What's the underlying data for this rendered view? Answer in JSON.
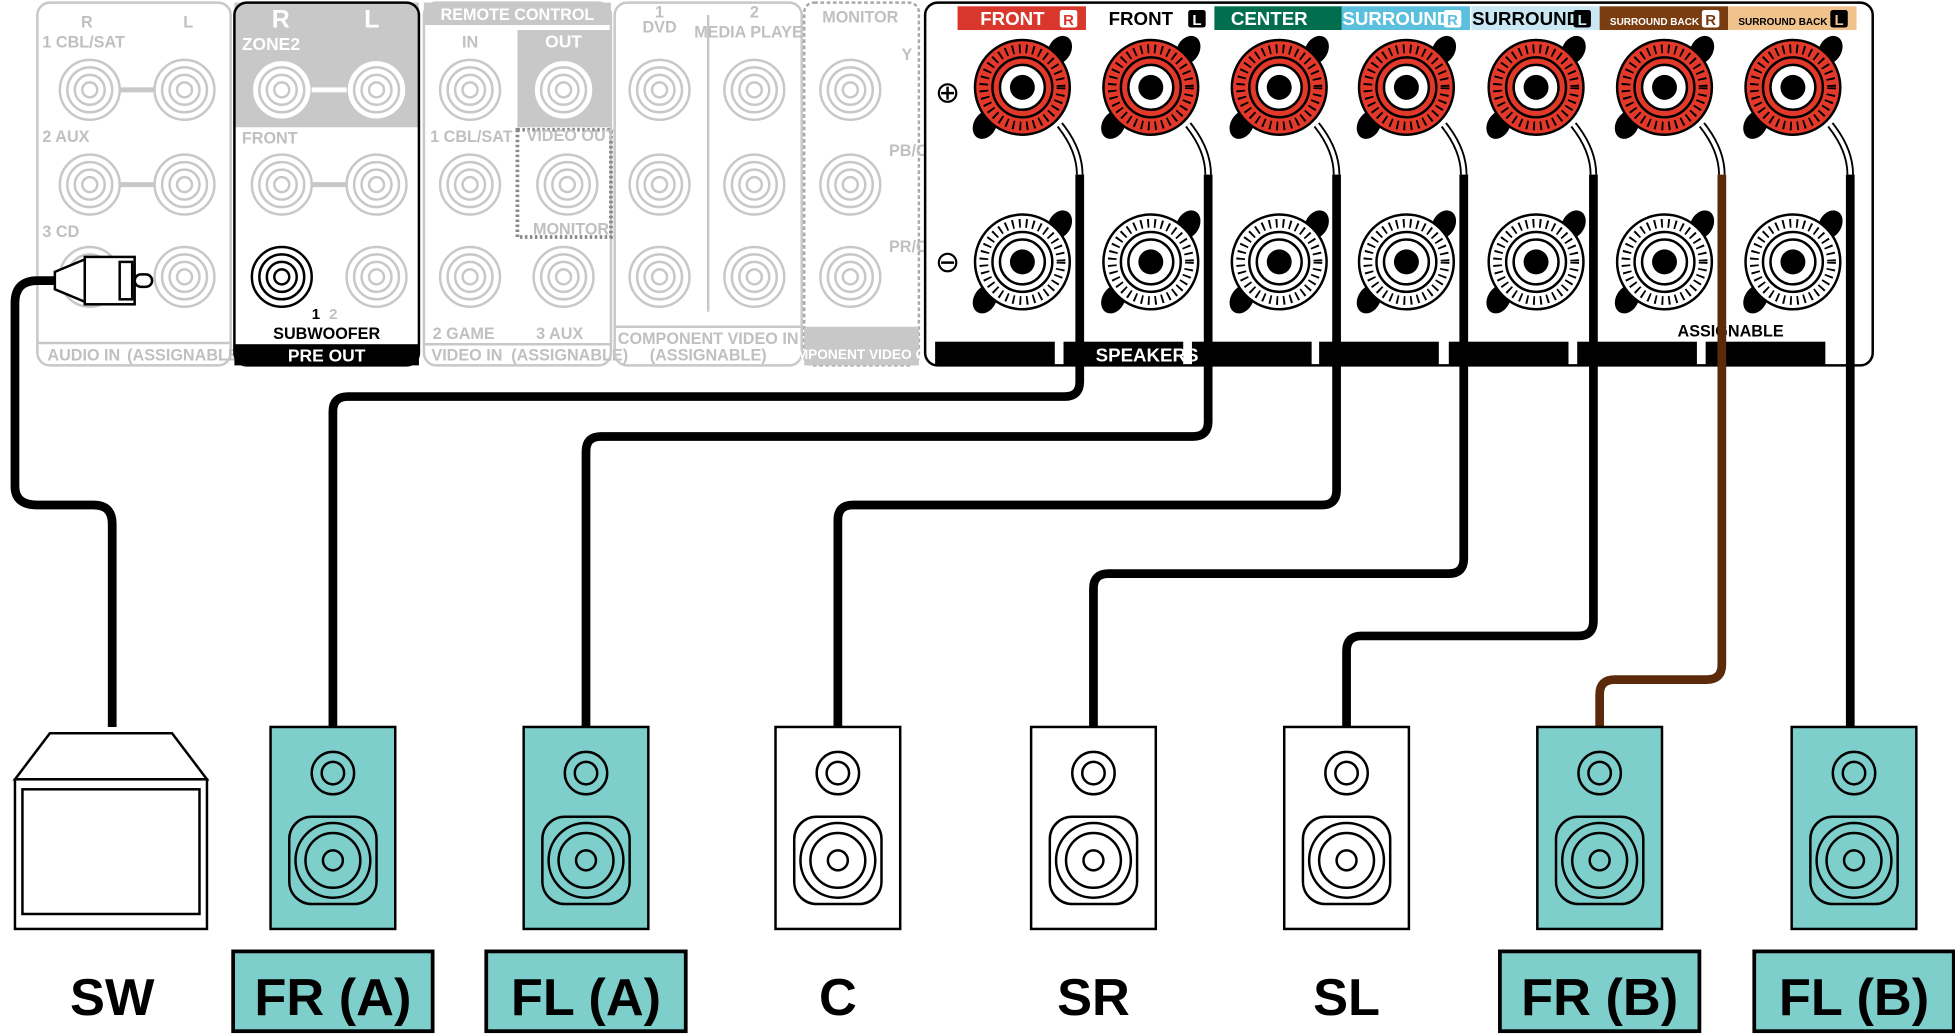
{
  "receiver": {
    "audio_in": {
      "r": "R",
      "l": "L",
      "inputs": [
        "1\nCBL/SAT",
        "2\nAUX",
        "3\nCD"
      ],
      "title": "AUDIO IN",
      "title_sub": "(ASSIGNABLE)"
    },
    "pre_out": {
      "r": "R",
      "l": "L",
      "zone2": "ZONE2",
      "front": "FRONT",
      "sub_num1": "1",
      "sub_num2": "2",
      "subwoofer": "SUBWOOFER",
      "title": "PRE OUT"
    },
    "remote_control": {
      "title": "REMOTE CONTROL",
      "in": "IN",
      "out": "OUT"
    },
    "video_in": {
      "cbl": "1 CBL/SAT",
      "video_out": "VIDEO OUT",
      "monitor": "MONITOR",
      "game": "2 GAME",
      "aux": "3 AUX",
      "title": "VIDEO IN",
      "title_sub": "(ASSIGNABLE)"
    },
    "component_in": {
      "dvd_num": "1",
      "dvd": "DVD",
      "mp_num": "2",
      "mp": "MEDIA PLAYER",
      "title": "COMPONENT VIDEO IN",
      "title_sub": "(ASSIGNABLE)"
    },
    "component_out": {
      "monitor": "MONITOR",
      "y": "Y",
      "pb": "PB/CB",
      "pr": "PR/CR",
      "title": "COMPONENT VIDEO OUT"
    },
    "speakers_panel": {
      "plus": "⊕",
      "minus": "⊖",
      "title": "SPEAKERS",
      "assignable": "ASSIGNABLE",
      "channels": [
        {
          "name": "FRONT",
          "side": "R",
          "bg": "#d9372b",
          "fg": "#ffffff"
        },
        {
          "name": "FRONT",
          "side": "L",
          "bg": "#ffffff",
          "fg": "#000000"
        },
        {
          "name": "CENTER",
          "side": "",
          "bg": "#006e4f",
          "fg": "#ffffff"
        },
        {
          "name": "SURROUND",
          "side": "R",
          "bg": "#5bbfde",
          "fg": "#ffffff"
        },
        {
          "name": "SURROUND",
          "side": "L",
          "bg": "#c9e8f3",
          "fg": "#000000"
        },
        {
          "name": "SURROUND BACK",
          "side": "R",
          "bg": "#7a3d12",
          "fg": "#ffffff"
        },
        {
          "name": "SURROUND BACK",
          "side": "L",
          "bg": "#f0c28c",
          "fg": "#000000"
        }
      ]
    }
  },
  "speakers": [
    {
      "label": "SW",
      "type": "subwoofer",
      "highlight": false
    },
    {
      "label": "FR (A)",
      "type": "speaker",
      "highlight": true
    },
    {
      "label": "FL (A)",
      "type": "speaker",
      "highlight": true
    },
    {
      "label": "C",
      "type": "speaker",
      "highlight": false
    },
    {
      "label": "SR",
      "type": "speaker",
      "highlight": false
    },
    {
      "label": "SL",
      "type": "speaker",
      "highlight": false
    },
    {
      "label": "FR (B)",
      "type": "speaker",
      "highlight": true
    },
    {
      "label": "FL (B)",
      "type": "speaker",
      "highlight": true
    }
  ],
  "colors": {
    "highlight": "#7ecfcb",
    "terminal_plus": "#e3392a",
    "wire": "#000000",
    "wire_brown": "#5a2a0a",
    "panel_gray": "#c8c8c8"
  }
}
